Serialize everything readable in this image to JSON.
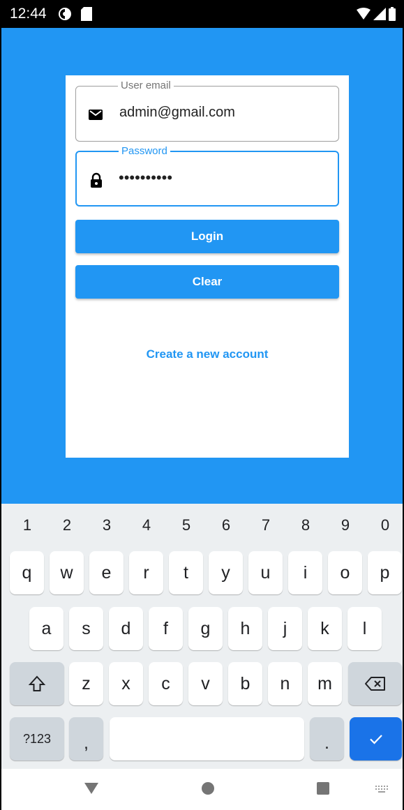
{
  "status_bar": {
    "time": "12:44"
  },
  "login": {
    "email_label": "User email",
    "email_value": "admin@gmail.com",
    "password_label": "Password",
    "password_value": "••••••••••",
    "login_button": "Login",
    "clear_button": "Clear",
    "create_account_link": "Create a new account"
  },
  "keyboard": {
    "numbers": [
      "1",
      "2",
      "3",
      "4",
      "5",
      "6",
      "7",
      "8",
      "9",
      "0"
    ],
    "row1": [
      "q",
      "w",
      "e",
      "r",
      "t",
      "y",
      "u",
      "i",
      "o",
      "p"
    ],
    "row2": [
      "a",
      "s",
      "d",
      "f",
      "g",
      "h",
      "j",
      "k",
      "l"
    ],
    "row3": [
      "z",
      "x",
      "c",
      "v",
      "b",
      "n",
      "m"
    ],
    "symbols_key": "?123",
    "comma_key": ",",
    "period_key": "."
  },
  "colors": {
    "app_background": "#2196f3",
    "accent": "#2196f3",
    "keyboard_background": "#eceff1",
    "enter_key": "#1a73e8"
  },
  "icons": [
    "mail-icon",
    "lock-icon",
    "shift-icon",
    "backspace-icon",
    "check-icon",
    "nav-back-icon",
    "nav-home-icon",
    "nav-recents-icon",
    "keyboard-switch-icon"
  ]
}
